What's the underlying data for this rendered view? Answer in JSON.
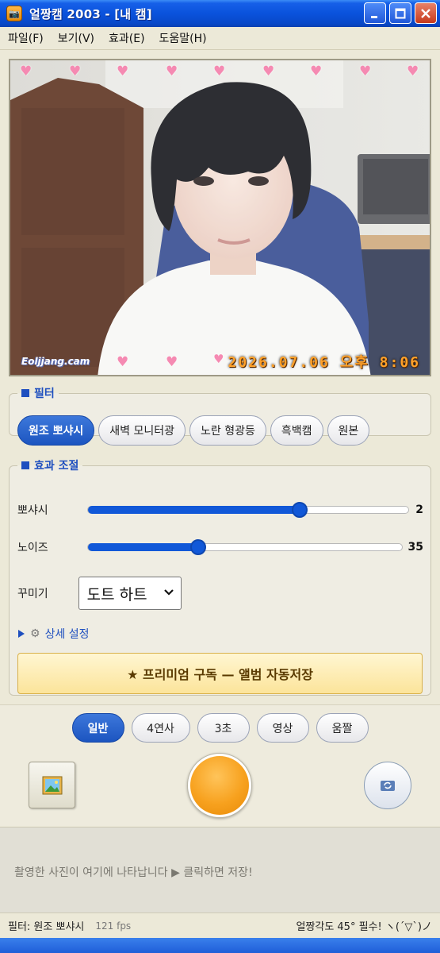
{
  "window": {
    "title": "얼짱캠 2003 - [내 캠]",
    "icon": "camera-icon",
    "buttons": [
      "minimize-icon",
      "maximize-icon",
      "close-icon"
    ]
  },
  "menu": {
    "items": [
      "파일(F)",
      "보기(V)",
      "효과(E)",
      "도움말(H)"
    ]
  },
  "camera": {
    "watermark": "Eoljjang.cam",
    "timestamp": "2026.07.06 오후 8:06",
    "heart_color": "#F58AB2"
  },
  "filter_group": {
    "legend": "필터",
    "filters": [
      "원조 뽀샤시",
      "새벽 모니터광",
      "노란 형광등",
      "흑백캠",
      "원본"
    ],
    "active_index": 0
  },
  "effects_group": {
    "legend": "효과 조절",
    "sliders": [
      {
        "label": "뽀샤시",
        "value": "2",
        "fraction": 0.66
      },
      {
        "label": "노이즈",
        "value": "35",
        "fraction": 0.35
      }
    ],
    "decoration_label": "꾸미기",
    "decoration_value": "도트 하트",
    "advanced_label": "상세 설정",
    "premium_label": "★ 프리미엄 구독 — 앨범 자동저장"
  },
  "capture": {
    "modes": [
      "일반",
      "4연사",
      "3초",
      "영상",
      "움짤"
    ],
    "active_mode": 0,
    "gallery_icon": "picture-icon",
    "shutter_color": "#F7A11E",
    "switch_icon": "camera-switch-icon"
  },
  "preview": {
    "hint": "촬영한 사진이 여기에 나타납니다 ▶ 클릭하면 저장!"
  },
  "status": {
    "filter_text": "필터: 원조 뽀샤시",
    "fps": "121 fps",
    "tip": "얼짱각도 45° 필수! ヽ(´▽`)ノ"
  },
  "colors": {
    "accent": "#1E4FBF",
    "titlebar": "#0A52DC",
    "window_bg": "#ECE9D8"
  }
}
